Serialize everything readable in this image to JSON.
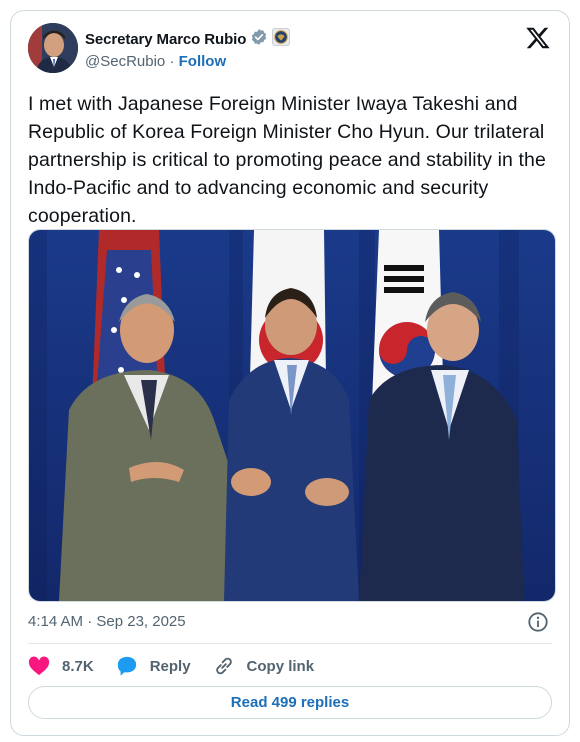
{
  "author": {
    "name": "Secretary Marco Rubio",
    "handle": "@SecRubio",
    "separator": "·",
    "follow_label": "Follow"
  },
  "post": {
    "text": "I met with Japanese Foreign Minister Iwaya Takeshi and Republic of Korea Foreign Minister Cho Hyun. Our trilateral partnership is critical to promoting peace and stability in the Indo-Pacific and to advancing economic and security cooperation.",
    "timestamp": "4:14 AM · Sep 23, 2025"
  },
  "actions": {
    "likes": "8.7K",
    "reply_label": "Reply",
    "copy_link_label": "Copy link"
  },
  "read_replies_label": "Read 499 replies",
  "colors": {
    "accent": "#1d6fb8",
    "heart": "#f91880",
    "reply_bubble": "#1d9bf0",
    "verified": "#829aab",
    "text_secondary": "#536471"
  },
  "icons": [
    "verified-badge-icon",
    "state-department-seal-icon",
    "x-logo-icon",
    "info-icon",
    "heart-icon",
    "reply-bubble-icon",
    "link-icon"
  ]
}
